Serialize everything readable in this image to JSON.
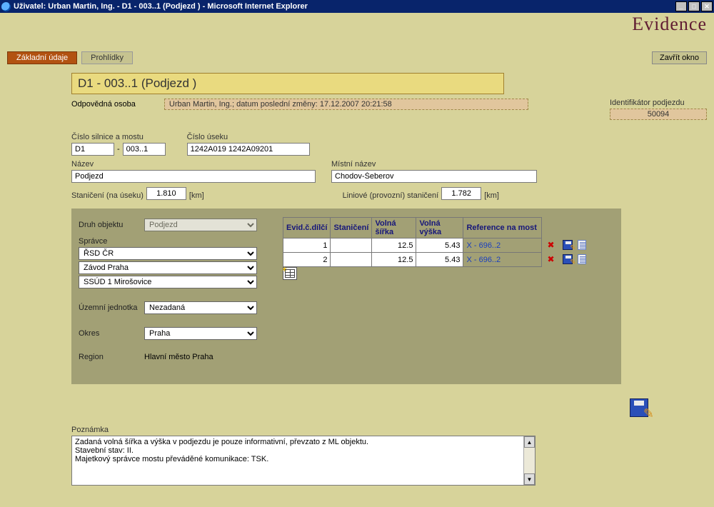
{
  "window": {
    "title": "Uživatel: Urban Martin, Ing. - D1 - 003..1 (Podjezd ) - Microsoft Internet Explorer"
  },
  "brand": "Evidence",
  "tabs": {
    "basic": "Základní údaje",
    "inspections": "Prohlídky"
  },
  "close_button": "Zavřít okno",
  "heading": "D1 - 003..1 (Podjezd )",
  "responsible": {
    "label": "Odpovědná osoba",
    "value": "Urban Martin, Ing.; datum poslední změny: 17.12.2007 20:21:58"
  },
  "identifier": {
    "label": "Identifikátor podjezdu",
    "value": "50094"
  },
  "fields": {
    "road_bridge_no_label": "Číslo silnice a mostu",
    "road_no": "D1",
    "bridge_no": "003..1",
    "section_no_label": "Číslo úseku",
    "section_no": "1242A019 1242A09201",
    "name_label": "Název",
    "name": "Podjezd",
    "local_name_label": "Místní název",
    "local_name": "Chodov-Šeberov",
    "stationing_label": "Staničení (na úseku)",
    "stationing": "1.810",
    "km": "[km]",
    "line_stationing_label": "Liniové (provozní) staničení",
    "line_stationing": "1.782"
  },
  "panel": {
    "object_type_label": "Druh objektu",
    "object_type": "Podjezd",
    "admin_label": "Správce",
    "admin1": "ŘSD ČR",
    "admin2": "Závod Praha",
    "admin3": "SSÚD 1 Mirošovice",
    "territorial_unit_label": "Územní jednotka",
    "territorial_unit": "Nezadaná",
    "district_label": "Okres",
    "district": "Praha",
    "region_label": "Region",
    "region": "Hlavní město Praha"
  },
  "grid": {
    "headers": {
      "partial": "Evid.č.dílčí",
      "stationing": "Staničení",
      "free_width": "Volná šířka",
      "free_height": "Volná výška",
      "ref": "Reference na most"
    },
    "rows": [
      {
        "partial": "1",
        "stationing": "",
        "free_width": "12.5",
        "free_height": "5.43",
        "ref": "X - 696..2"
      },
      {
        "partial": "2",
        "stationing": "",
        "free_width": "12.5",
        "free_height": "5.43",
        "ref": "X - 696..2"
      }
    ]
  },
  "note": {
    "label": "Poznámka",
    "text": "Zadaná volná šířka a výška v podjezdu je pouze informativní, převzato z ML objektu.\nStavební stav: II.\nMajetkový správce mostu převáděné komunikace: TSK."
  }
}
